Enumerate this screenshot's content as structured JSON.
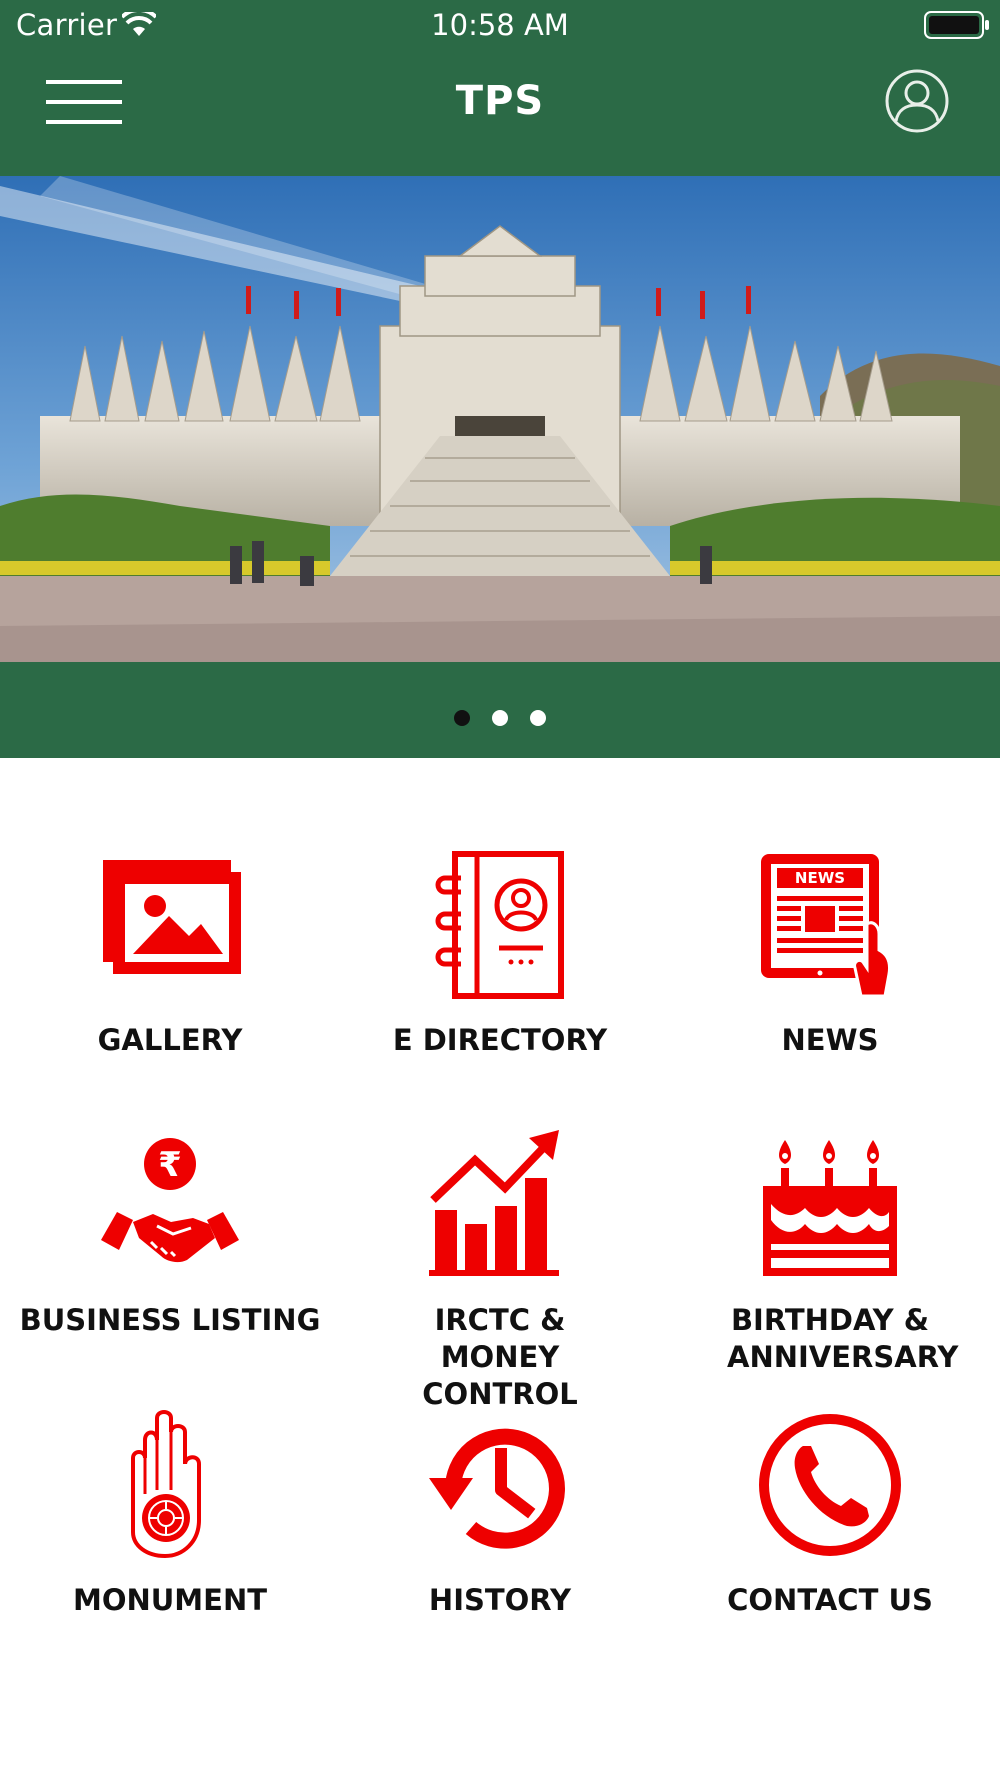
{
  "status_bar": {
    "carrier": "Carrier",
    "time": "10:58 AM"
  },
  "nav": {
    "title": "TPS",
    "menu_icon": "hamburger-icon",
    "profile_icon": "user-circle-icon"
  },
  "banner": {
    "image": "jain temple photo",
    "page_count": 3,
    "active_page": 1
  },
  "tiles": [
    {
      "label": "GALLERY",
      "icon": "gallery-icon"
    },
    {
      "label": "E DIRECTORY",
      "icon": "directory-icon"
    },
    {
      "label": "NEWS",
      "icon": "news-icon"
    },
    {
      "label": "BUSINESS LISTING",
      "icon": "handshake-rupee-icon"
    },
    {
      "label": "IRCTC & MONEY CONTROL",
      "icon": "growth-chart-icon"
    },
    {
      "label": "BIRTHDAY & ANNIVERSARY",
      "icon": "cake-icon"
    },
    {
      "label": "MONUMENT",
      "icon": "ahimsa-hand-icon"
    },
    {
      "label": "HISTORY",
      "icon": "history-icon"
    },
    {
      "label": "CONTACT US",
      "icon": "phone-icon"
    }
  ],
  "icon_text": {
    "news_badge": "NEWS",
    "rupee": "₹"
  },
  "colors": {
    "primary_green": "#2b6a46",
    "accent_red": "#ee0000",
    "label_text": "#111111",
    "dot_active": "#111111",
    "dot_inactive": "#ffffff"
  }
}
